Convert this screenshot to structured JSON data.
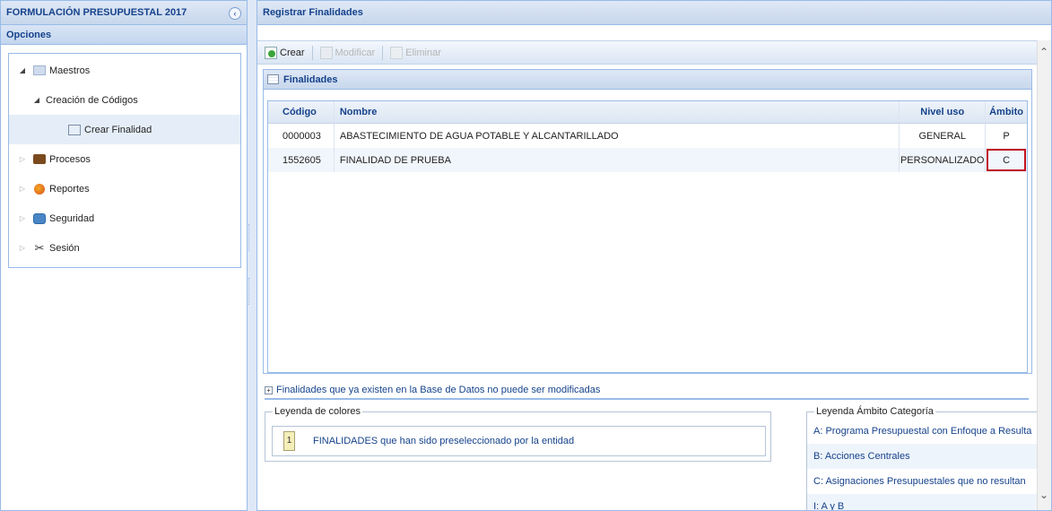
{
  "left": {
    "title": "FORMULACIÓN PRESUPUESTAL 2017",
    "options_title": "Opciones",
    "tree": [
      {
        "label": "Maestros",
        "icon": "folder-icon"
      },
      {
        "label": "Creación de Códigos"
      },
      {
        "label": "Crear Finalidad",
        "icon": "finalidad-icon"
      },
      {
        "label": "Procesos",
        "icon": "procesos-icon"
      },
      {
        "label": "Reportes",
        "icon": "reportes-icon"
      },
      {
        "label": "Seguridad",
        "icon": "seguridad-icon"
      },
      {
        "label": "Sesión",
        "icon": "sesion-icon"
      }
    ]
  },
  "main": {
    "title": "Registrar Finalidades",
    "toolbar": {
      "crear": "Crear",
      "modificar": "Modificar",
      "eliminar": "Eliminar"
    },
    "panel_title": "Finalidades",
    "columns": [
      "Código",
      "Nombre",
      "Nivel uso",
      "Ámbito"
    ],
    "rows": [
      {
        "codigo": "0000003",
        "nombre": "ABASTECIMIENTO DE AGUA POTABLE Y ALCANTARILLADO",
        "nivel": "GENERAL",
        "ambito": "P"
      },
      {
        "codigo": "1552605",
        "nombre": "FINALIDAD DE PRUEBA",
        "nivel": "PERSONALIZADO",
        "ambito": "C"
      }
    ],
    "note": "Finalidades que ya existen en la Base de Datos no puede ser modificadas",
    "legend_colores": {
      "title": "Leyenda de colores",
      "swatch": "1",
      "text": "FINALIDADES que han sido preseleccionado por la entidad"
    },
    "legend_ambito": {
      "title": "Leyenda Ámbito Categoría",
      "items": [
        "A: Programa Presupuestal con Enfoque a Resulta",
        "B: Acciones Centrales",
        "C: Asignaciones Presupuestales que no resultan",
        "I: A y B"
      ]
    }
  },
  "colors": {
    "header_text": "#15428b",
    "border": "#99bbe8",
    "highlight": "#c0121e"
  }
}
